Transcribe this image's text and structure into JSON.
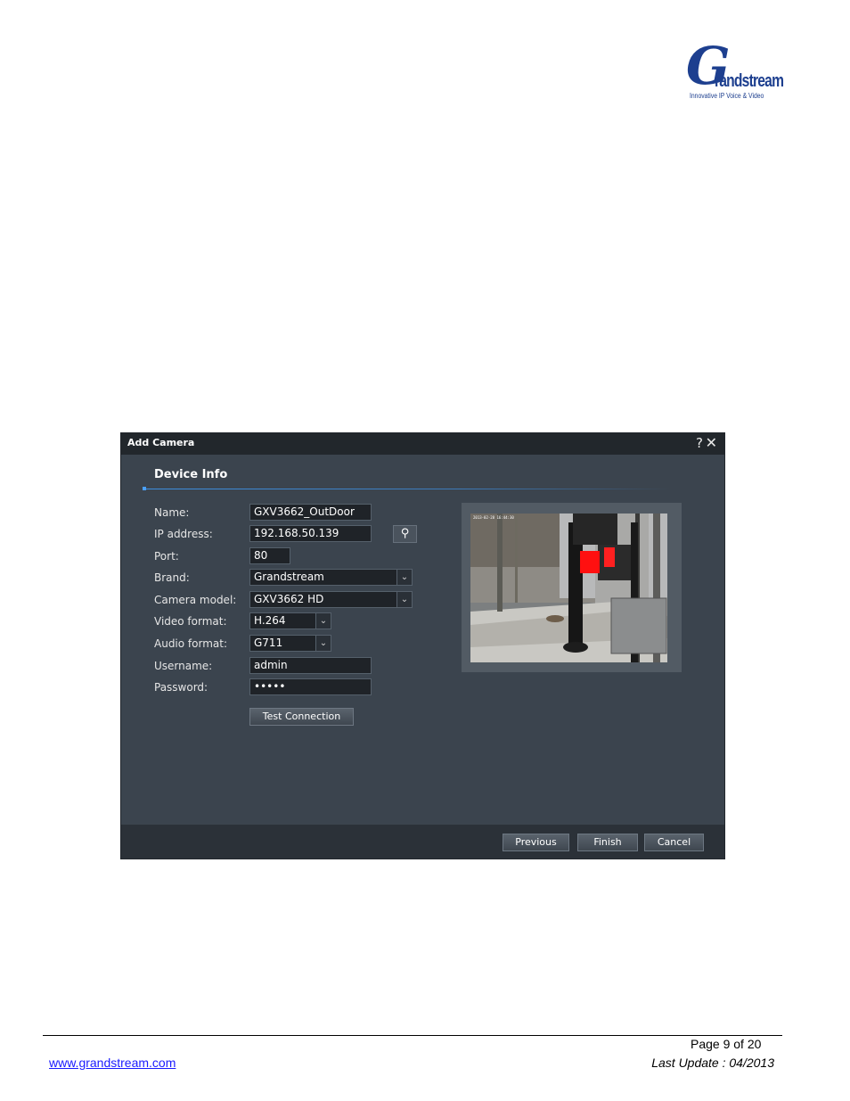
{
  "logo": {
    "initial": "G",
    "wordmark": "randstream",
    "tagline": "Innovative IP Voice & Video",
    "color": "#1d3f8f"
  },
  "dialog": {
    "title": "Add Camera",
    "help_icon": "question-mark-icon",
    "close_icon": "close-icon",
    "section_title": "Device Info",
    "fields": {
      "name": {
        "label": "Name:",
        "value": "GXV3662_OutDoor"
      },
      "ip_address": {
        "label": "IP address:",
        "value": "192.168.50.139"
      },
      "port": {
        "label": "Port:",
        "value": "80"
      },
      "brand": {
        "label": "Brand:",
        "value": "Grandstream"
      },
      "camera_model": {
        "label": "Camera model:",
        "value": "GXV3662 HD"
      },
      "video_format": {
        "label": "Video format:",
        "value": "H.264"
      },
      "audio_format": {
        "label": "Audio format:",
        "value": "G711"
      },
      "username": {
        "label": "Username:",
        "value": "admin"
      },
      "password": {
        "label": "Password:",
        "value": "•••••"
      }
    },
    "search_icon": "magnifier-icon",
    "test_connection": "Test Connection",
    "buttons": {
      "previous": "Previous",
      "finish": "Finish",
      "cancel": "Cancel"
    },
    "preview_overlay_text": "2013-02-28 16:44:30",
    "accent_color": "#3d8fe0"
  },
  "footer": {
    "page": "Page 9 of 20",
    "website": "www.grandstream.com",
    "last_update": "Last Update : 04/2013"
  }
}
